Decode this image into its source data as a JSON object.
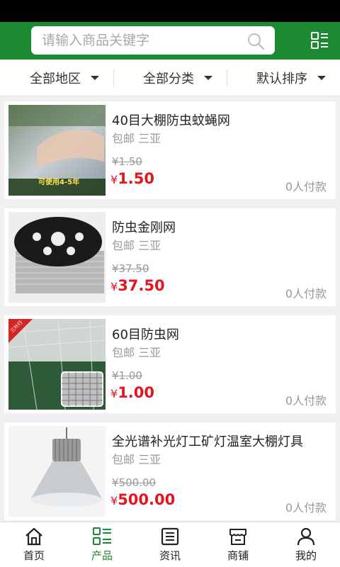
{
  "search": {
    "placeholder": "请输入商品关键字"
  },
  "filters": {
    "region": "全部地区",
    "category": "全部分类",
    "sort": "默认排序"
  },
  "products": [
    {
      "title": "40目大棚防虫蚊蝇网",
      "shipping": "包邮 三亚",
      "old_price": "¥1.50",
      "currency": "¥",
      "price": "1.50",
      "paid": "0人付款",
      "image_caption": "可使用4-5年"
    },
    {
      "title": "防虫金刚网",
      "shipping": "包邮 三亚",
      "old_price": "¥37.50",
      "currency": "¥",
      "price": "37.50",
      "paid": "0人付款"
    },
    {
      "title": "60目防虫网",
      "shipping": "包邮 三亚",
      "old_price": "¥1.00",
      "currency": "¥",
      "price": "1.00",
      "paid": "0人付款",
      "image_badge": "三叶行"
    },
    {
      "title": "全光谱补光灯工矿灯温室大棚灯具",
      "shipping": "包邮 三亚",
      "old_price": "¥500.00",
      "currency": "¥",
      "price": "500.00",
      "paid": "0人付款"
    }
  ],
  "tabs": [
    {
      "label": "首页",
      "icon": "home-icon"
    },
    {
      "label": "产品",
      "icon": "product-list-icon"
    },
    {
      "label": "资讯",
      "icon": "news-icon"
    },
    {
      "label": "商铺",
      "icon": "store-icon"
    },
    {
      "label": "我的",
      "icon": "user-icon"
    }
  ],
  "colors": {
    "brand": "#1c8a32",
    "price": "#e4151f"
  }
}
